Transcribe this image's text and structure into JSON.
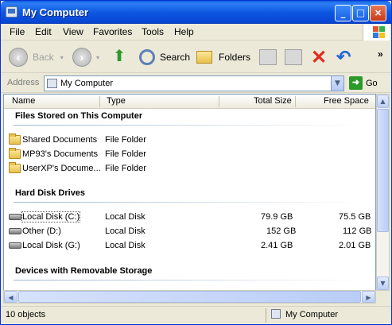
{
  "window": {
    "title": "My Computer"
  },
  "title_buttons": {
    "minimize": "_",
    "maximize": "□",
    "close": "×"
  },
  "menu": [
    "File",
    "Edit",
    "View",
    "Favorites",
    "Tools",
    "Help"
  ],
  "toolbar": {
    "back": "Back",
    "search": "Search",
    "folders": "Folders"
  },
  "address": {
    "label": "Address",
    "value": "My Computer",
    "go": "Go"
  },
  "columns": {
    "name": "Name",
    "type": "Type",
    "total": "Total Size",
    "free": "Free Space"
  },
  "groups": {
    "stored": "Files Stored on This Computer",
    "hdd": "Hard Disk Drives",
    "removable": "Devices with Removable Storage"
  },
  "stored_items": [
    {
      "name": "Shared Documents",
      "type": "File Folder"
    },
    {
      "name": "MP93's Documents",
      "type": "File Folder"
    },
    {
      "name": "UserXP's Docume...",
      "type": "File Folder"
    }
  ],
  "disks": [
    {
      "name": "Local Disk (C:)",
      "type": "Local Disk",
      "total": "79.9 GB",
      "free": "75.5 GB"
    },
    {
      "name": "Other (D:)",
      "type": "Local Disk",
      "total": "152 GB",
      "free": "112 GB"
    },
    {
      "name": "Local Disk (G:)",
      "type": "Local Disk",
      "total": "2.41 GB",
      "free": "2.01 GB"
    }
  ],
  "status": {
    "count": "10 objects",
    "location": "My Computer"
  },
  "colors": {
    "titlebar": "#0a5bd8",
    "close": "#c8391a",
    "go": "#2b9a2b"
  }
}
